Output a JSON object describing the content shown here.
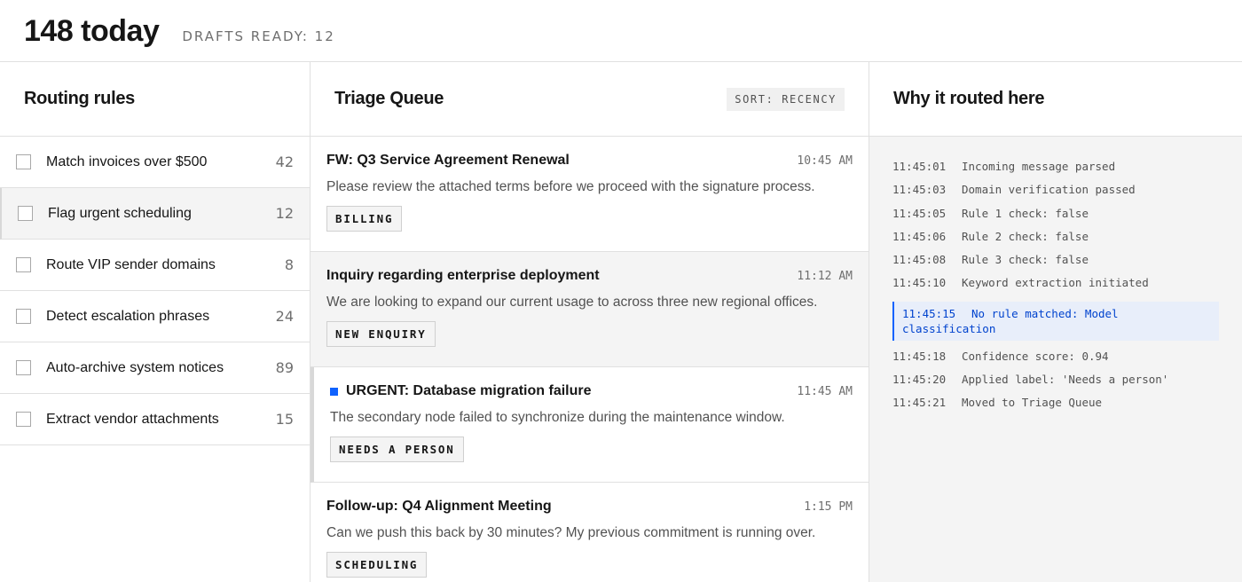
{
  "header": {
    "count": "148 today",
    "drafts": "DRAFTS READY: 12"
  },
  "rules": {
    "title": "Routing rules",
    "items": [
      {
        "label": "Match invoices over $500",
        "count": "42"
      },
      {
        "label": "Flag urgent scheduling",
        "count": "12"
      },
      {
        "label": "Route VIP sender domains",
        "count": "8"
      },
      {
        "label": "Detect escalation phrases",
        "count": "24"
      },
      {
        "label": "Auto-archive system notices",
        "count": "89"
      },
      {
        "label": "Extract vendor attachments",
        "count": "15"
      }
    ]
  },
  "queue": {
    "title": "Triage Queue",
    "sort": "SORT: RECENCY",
    "messages": [
      {
        "subject": "FW: Q3 Service Agreement Renewal",
        "time": "10:45 AM",
        "preview": "Please review the attached terms before we proceed with the signature process.",
        "tag": "BILLING"
      },
      {
        "subject": "Inquiry regarding enterprise deployment",
        "time": "11:12 AM",
        "preview": "We are looking to expand our current usage to across three new regional offices.",
        "tag": "NEW ENQUIRY"
      },
      {
        "subject": "URGENT: Database migration failure",
        "time": "11:45 AM",
        "preview": "The secondary node failed to synchronize during the maintenance window.",
        "tag": "NEEDS A PERSON"
      },
      {
        "subject": "Follow-up: Q4 Alignment Meeting",
        "time": "1:15 PM",
        "preview": "Can we push this back by 30 minutes? My previous commitment is running over.",
        "tag": "SCHEDULING"
      }
    ]
  },
  "why": {
    "title": "Why it routed here",
    "log": [
      {
        "time": "11:45:01",
        "text": "Incoming message parsed"
      },
      {
        "time": "11:45:03",
        "text": "Domain verification passed"
      },
      {
        "time": "11:45:05",
        "text": "Rule 1 check: false"
      },
      {
        "time": "11:45:06",
        "text": "Rule 2 check: false"
      },
      {
        "time": "11:45:08",
        "text": "Rule 3 check: false"
      },
      {
        "time": "11:45:10",
        "text": "Keyword extraction initiated"
      },
      {
        "time": "11:45:15",
        "text": "No rule matched: Model classification"
      },
      {
        "time": "11:45:18",
        "text": "Confidence score: 0.94"
      },
      {
        "time": "11:45:20",
        "text": "Applied label: 'Needs a person'"
      },
      {
        "time": "11:45:21",
        "text": "Moved to Triage Queue"
      }
    ]
  },
  "colors": {
    "accent": "#0f62fe",
    "highlight_bg": "#e8eefa"
  },
  "icons": {
    "urgent_marker": "square-marker-icon",
    "rule_toggle": "checkbox-icon"
  }
}
